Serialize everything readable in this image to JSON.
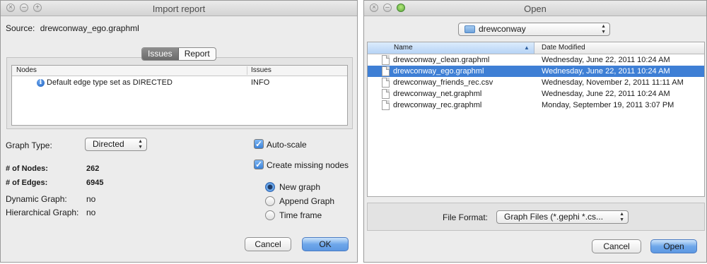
{
  "import_report": {
    "title": "Import report",
    "source_label": "Source:",
    "source_value": "drewconway_ego.graphml",
    "tabs": [
      "Issues",
      "Report"
    ],
    "table": {
      "headers": [
        "Nodes",
        "Issues"
      ],
      "rows": [
        {
          "icon": "info-icon",
          "message": "Default edge type set as DIRECTED",
          "level": "INFO"
        }
      ]
    },
    "graph_type_label": "Graph Type:",
    "graph_type_value": "Directed",
    "stats": [
      {
        "label": "# of Nodes:",
        "value": "262"
      },
      {
        "label": "# of Edges:",
        "value": "6945"
      },
      {
        "label": "Dynamic Graph:",
        "value": "no"
      },
      {
        "label": "Hierarchical Graph:",
        "value": "no"
      }
    ],
    "checkboxes": [
      {
        "label": "Auto-scale",
        "checked": true
      },
      {
        "label": "Create missing nodes",
        "checked": true
      }
    ],
    "radios": [
      {
        "label": "New graph",
        "selected": true
      },
      {
        "label": "Append Graph",
        "selected": false
      },
      {
        "label": "Time frame",
        "selected": false
      }
    ],
    "cancel_label": "Cancel",
    "ok_label": "OK"
  },
  "open_dialog": {
    "title": "Open",
    "folder": "drewconway",
    "columns": {
      "name": "Name",
      "date": "Date Modified"
    },
    "files": [
      {
        "name": "drewconway_clean.graphml",
        "date": "Wednesday, June 22, 2011 10:24 AM",
        "selected": false
      },
      {
        "name": "drewconway_ego.graphml",
        "date": "Wednesday, June 22, 2011 10:24 AM",
        "selected": true
      },
      {
        "name": "drewconway_friends_rec.csv",
        "date": "Wednesday, November 2, 2011 11:11 AM",
        "selected": false
      },
      {
        "name": "drewconway_net.graphml",
        "date": "Wednesday, June 22, 2011 10:24 AM",
        "selected": false
      },
      {
        "name": "drewconway_rec.graphml",
        "date": "Monday, September 19, 2011 3:07 PM",
        "selected": false
      }
    ],
    "file_format_label": "File Format:",
    "file_format_value": "Graph Files (*.gephi *.cs...",
    "cancel_label": "Cancel",
    "open_label": "Open"
  },
  "colors": {
    "selection": "#3e7fd5",
    "window_bg": "#ececec",
    "primary_button": "#6ea7ea"
  }
}
